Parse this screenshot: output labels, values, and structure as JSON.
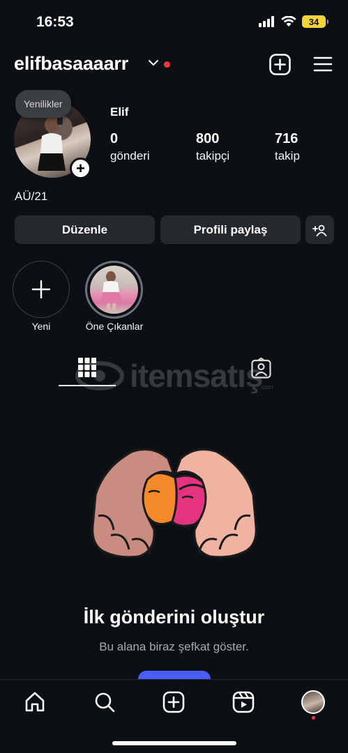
{
  "status_bar": {
    "time": "16:53",
    "battery": "34"
  },
  "header": {
    "username": "elifbasaaaarr",
    "icons": [
      "chevron-down-icon",
      "new-post-plus-icon",
      "hamburger-menu-icon"
    ],
    "notification_dot_color": "#ff3040"
  },
  "profile": {
    "bubble_note": "Yenilikler",
    "display_name": "Elif",
    "bio": "AÜ/21",
    "stats": [
      {
        "value": "0",
        "label": "gönderi"
      },
      {
        "value": "800",
        "label": "takipçi"
      },
      {
        "value": "716",
        "label": "takip"
      }
    ]
  },
  "actions": {
    "edit": "Düzenle",
    "share": "Profili paylaş"
  },
  "highlights": [
    {
      "label": "Yeni"
    },
    {
      "label": "Öne Çıkanlar"
    }
  ],
  "tabs": [
    "grid-icon",
    "tagged-icon"
  ],
  "watermark": {
    "text": "itemsatış",
    "small": ".com"
  },
  "empty_state": {
    "title": "İlk gönderini oluştur",
    "subtitle": "Bu alana biraz şefkat göster."
  },
  "bottom_nav": [
    "home-icon",
    "search-icon",
    "create-icon",
    "reels-icon",
    "profile-avatar"
  ],
  "colors": {
    "background": "#0c1014",
    "button": "#25292e",
    "accent": "#4a5df9",
    "muted_text": "#a8a8a8"
  }
}
